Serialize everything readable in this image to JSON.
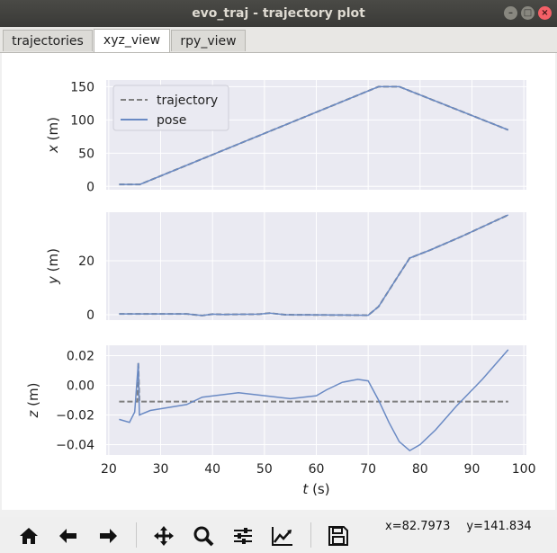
{
  "window": {
    "title": "evo_traj - trajectory plot"
  },
  "tabs": [
    {
      "label": "trajectories"
    },
    {
      "label": "xyz_view"
    },
    {
      "label": "rpy_view"
    }
  ],
  "status": {
    "x": "x=82.7973",
    "y": "y=141.834"
  },
  "toolbar": {
    "icons": [
      "home-icon",
      "back-icon",
      "forward-icon",
      "pan-icon",
      "zoom-icon",
      "configure-subplots-icon",
      "edit-axis-icon",
      "save-icon"
    ]
  },
  "colors": {
    "trajectory": "#7f7f7f",
    "pose": "#6a8ac4",
    "plot_bg": "#eaeaf2"
  },
  "chart_data": [
    {
      "type": "line",
      "ylabel": "x (m)",
      "xlabel": "",
      "xlim": [
        19.5,
        100.5
      ],
      "ylim": [
        -5,
        160
      ],
      "yticks": [
        0,
        50,
        100,
        150
      ],
      "legend": {
        "placement": "top-left",
        "entries": [
          "trajectory",
          "pose"
        ]
      },
      "series": [
        {
          "name": "trajectory",
          "style": "dashed",
          "x": [
            22,
            26,
            72,
            76,
            97
          ],
          "y": [
            3,
            3,
            150,
            150,
            85
          ]
        },
        {
          "name": "pose",
          "style": "solid",
          "x": [
            22,
            26,
            72,
            76,
            97
          ],
          "y": [
            3,
            3,
            150,
            150,
            85
          ]
        }
      ]
    },
    {
      "type": "line",
      "ylabel": "y (m)",
      "xlabel": "",
      "xlim": [
        19.5,
        100.5
      ],
      "ylim": [
        -2,
        38
      ],
      "yticks": [
        0,
        20
      ],
      "series": [
        {
          "name": "trajectory",
          "style": "dashed",
          "x": [
            22,
            35,
            38,
            40,
            42,
            49,
            51,
            54,
            70,
            72,
            76,
            78,
            82,
            88,
            97
          ],
          "y": [
            0.3,
            0.3,
            -0.3,
            0.2,
            0.1,
            0.2,
            0.6,
            0,
            -0.2,
            3,
            15,
            21,
            24,
            29,
            37
          ]
        },
        {
          "name": "pose",
          "style": "solid",
          "x": [
            22,
            35,
            38,
            40,
            42,
            49,
            51,
            54,
            70,
            72,
            76,
            78,
            82,
            88,
            97
          ],
          "y": [
            0.3,
            0.3,
            -0.3,
            0.2,
            0.1,
            0.2,
            0.6,
            0,
            -0.2,
            3,
            15,
            21,
            24,
            29,
            37
          ]
        }
      ]
    },
    {
      "type": "line",
      "ylabel": "z (m)",
      "xlabel": "t (s)",
      "xlim": [
        19.5,
        100.5
      ],
      "ylim": [
        -0.047,
        0.027
      ],
      "yticks": [
        0.02,
        0.0,
        -0.02,
        -0.04
      ],
      "ytick_labels": [
        "0.02",
        "0.00",
        "−0.02",
        "−0.04"
      ],
      "xticks": [
        20,
        30,
        40,
        50,
        60,
        70,
        80,
        90,
        100
      ],
      "series": [
        {
          "name": "trajectory",
          "style": "dashed",
          "x": [
            22,
            25.5,
            25.7,
            25.9,
            26.1,
            97
          ],
          "y": [
            -0.011,
            -0.011,
            0.015,
            -0.011,
            -0.011,
            -0.011
          ]
        },
        {
          "name": "pose",
          "style": "solid",
          "x": [
            22,
            24,
            25,
            25.7,
            25.9,
            28,
            35,
            38,
            45,
            55,
            60,
            62,
            65,
            68,
            70,
            72,
            74,
            76,
            78,
            80,
            83,
            87,
            92,
            97
          ],
          "y": [
            -0.023,
            -0.025,
            -0.018,
            0.015,
            -0.02,
            -0.017,
            -0.013,
            -0.008,
            -0.005,
            -0.009,
            -0.007,
            -0.003,
            0.002,
            0.004,
            0.003,
            -0.01,
            -0.025,
            -0.038,
            -0.044,
            -0.04,
            -0.03,
            -0.014,
            0.004,
            0.024
          ]
        }
      ]
    }
  ]
}
